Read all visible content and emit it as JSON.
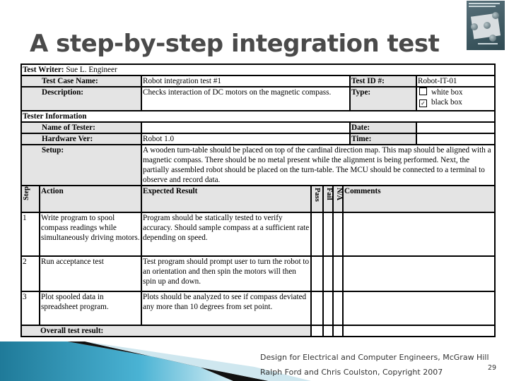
{
  "slide": {
    "title": "A step-by-step integration test",
    "page_number": "29",
    "footer_line1": "Design for Electrical and Computer Engineers, McGraw Hill",
    "footer_line2": "Ralph Ford and Chris Coulston, Copyright 2007",
    "book_cover_icon": "book-cover-thumbnail"
  },
  "header": {
    "test_writer_label": "Test Writer:",
    "test_writer_value": "Sue L. Engineer",
    "test_case_name_label": "Test Case Name:",
    "test_case_name_value": "Robot integration test #1",
    "test_id_label": "Test ID #:",
    "test_id_value": "Robot-IT-01",
    "description_label": "Description:",
    "description_value": "Checks interaction of DC motors on the magnetic compass.",
    "type_label": "Type:",
    "type_options": [
      {
        "label": "white box",
        "checked": false,
        "mark": ""
      },
      {
        "label": "black box",
        "checked": true,
        "mark": "✓"
      }
    ]
  },
  "tester_info": {
    "section_label": "Tester Information",
    "name_label": "Name of Tester:",
    "name_value": "",
    "date_label": "Date:",
    "date_value": "",
    "hardware_label": "Hardware Ver:",
    "hardware_value": "Robot 1.0",
    "time_label": "Time:",
    "time_value": "",
    "setup_label": "Setup:",
    "setup_value": "A wooden turn-table should be placed on top of the cardinal direction map. This map should be aligned with a magnetic compass. There should be no metal present while the alignment is being performed. Next, the partially assembled robot should be placed on the turn-table. The MCU should be connected to a terminal to observe and record data."
  },
  "steps_table": {
    "columns": {
      "step": "Step",
      "action": "Action",
      "expected": "Expected Result",
      "pass": "Pass",
      "fail": "Fail",
      "na": "N/A",
      "comments": "Comments"
    },
    "rows": [
      {
        "step": "1",
        "action": "Write program to spool compass readings while simultaneously driving motors.",
        "expected": "Program should be statically tested to verify accuracy. Should sample compass at a sufficient rate depending on speed.",
        "pass": "",
        "fail": "",
        "na": "",
        "comments": ""
      },
      {
        "step": "2",
        "action": "Run acceptance test",
        "expected": "Test program should prompt user to turn the robot to an orientation and then spin the motors will then spin up and down.",
        "pass": "",
        "fail": "",
        "na": "",
        "comments": ""
      },
      {
        "step": "3",
        "action": "Plot spooled data in spreadsheet program.",
        "expected": "Plots should be analyzed to see if compass deviated any more than 10 degrees from set point.",
        "pass": "",
        "fail": "",
        "na": "",
        "comments": ""
      }
    ],
    "overall_label": "Overall test result:"
  },
  "colors": {
    "label_fill": "#e4e4e4",
    "title_color": "#4a4a4a",
    "swoosh_blue": "#2a8fb0"
  }
}
